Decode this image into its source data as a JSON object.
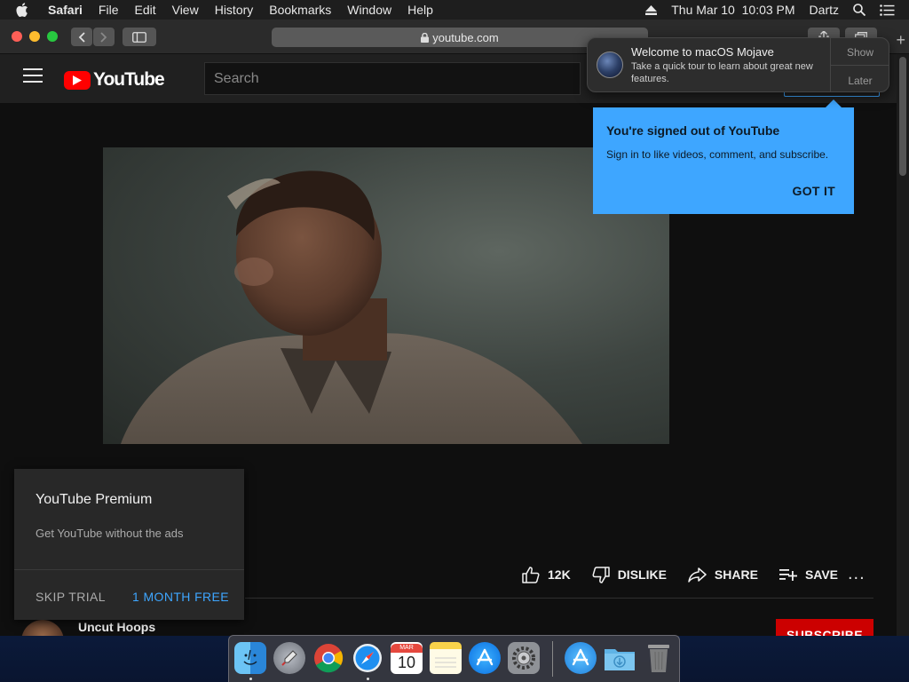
{
  "menubar": {
    "app": "Safari",
    "items": [
      "File",
      "Edit",
      "View",
      "History",
      "Bookmarks",
      "Window",
      "Help"
    ],
    "clock": "Thu Mar 10  10:03 PM",
    "user": "Dartz"
  },
  "browser": {
    "url": "youtube.com"
  },
  "youtube": {
    "logo_text": "YouTube",
    "search_placeholder": "Search"
  },
  "notification": {
    "title": "Welcome to macOS Mojave",
    "body": "Take a quick tour to learn about great new features.",
    "show_label": "Show",
    "later_label": "Later"
  },
  "signin_bubble": {
    "title": "You're signed out of YouTube",
    "text": "Sign in to like videos, comment, and subscribe.",
    "button": "GOT IT"
  },
  "actions": {
    "like_count": "12K",
    "dislike_label": "DISLIKE",
    "share_label": "SHARE",
    "save_label": "SAVE",
    "more_label": "..."
  },
  "channel": {
    "name": "Uncut Hoops",
    "subscribe_label": "SUBSCRIBE"
  },
  "premium_popup": {
    "title": "YouTube Premium",
    "description": "Get YouTube without the ads",
    "skip_label": "SKIP TRIAL",
    "trial_label": "1 MONTH FREE"
  },
  "dock": {
    "calendar_month": "MAR",
    "calendar_day": "10",
    "icons": [
      "finder-icon",
      "launchpad-icon",
      "chrome-icon",
      "safari-icon",
      "calendar-icon",
      "notes-icon",
      "app-store-icon",
      "system-preferences-icon",
      "applications-folder-icon",
      "downloads-folder-icon",
      "trash-icon"
    ]
  },
  "colors": {
    "yt_background": "#0f0f0f",
    "yt_header": "#202020",
    "accent_blue": "#3ea6ff",
    "subscribe_red": "#cc0000",
    "yt_red": "#ff0000"
  }
}
